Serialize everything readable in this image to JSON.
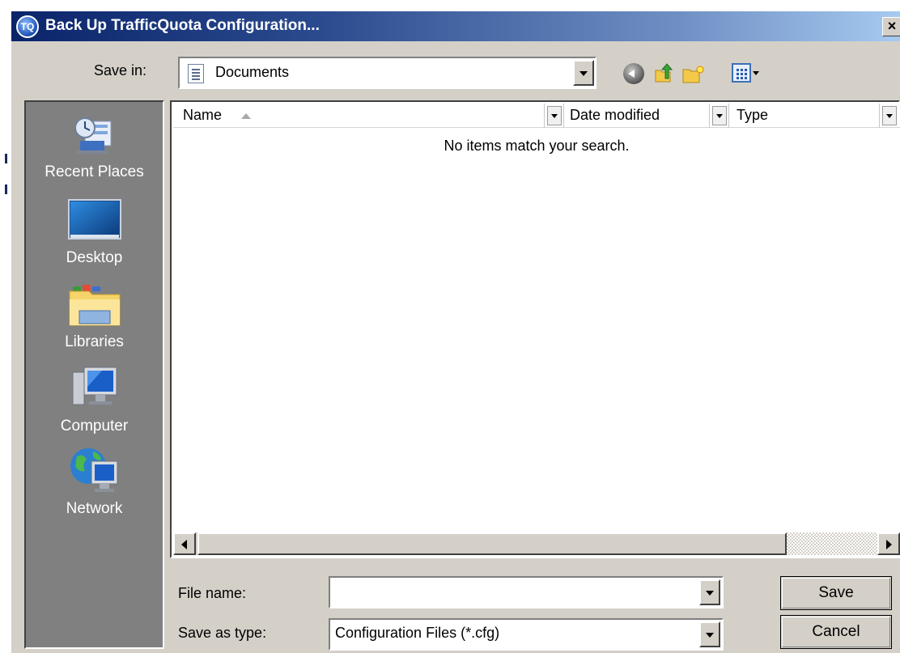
{
  "window": {
    "title": "Back Up TrafficQuota Configuration...",
    "app_icon_text": "TQ",
    "close_glyph": "×"
  },
  "save_in": {
    "label": "Save in:",
    "value": "Documents",
    "icon": "documents-folder-icon"
  },
  "toolbar": {
    "icons": [
      "back-icon",
      "up-one-level-icon",
      "new-folder-icon",
      "views-menu-icon"
    ]
  },
  "places": [
    {
      "label": "Recent Places",
      "icon": "recent-places-icon"
    },
    {
      "label": "Desktop",
      "icon": "desktop-icon"
    },
    {
      "label": "Libraries",
      "icon": "libraries-icon"
    },
    {
      "label": "Computer",
      "icon": "computer-icon"
    },
    {
      "label": "Network",
      "icon": "network-icon"
    }
  ],
  "file_list": {
    "columns": [
      "Name",
      "Date modified",
      "Type"
    ],
    "sort_column": "Name",
    "empty_message": "No items match your search."
  },
  "file_name": {
    "label": "File name:",
    "value": ""
  },
  "save_as_type": {
    "label": "Save as type:",
    "value": "Configuration Files (*.cfg)"
  },
  "buttons": {
    "save": "Save",
    "cancel": "Cancel"
  },
  "colors": {
    "titlebar_start": "#0a246a",
    "titlebar_end": "#a6caf0",
    "dialog_face": "#d4d0c8",
    "places_bar": "#808080"
  }
}
